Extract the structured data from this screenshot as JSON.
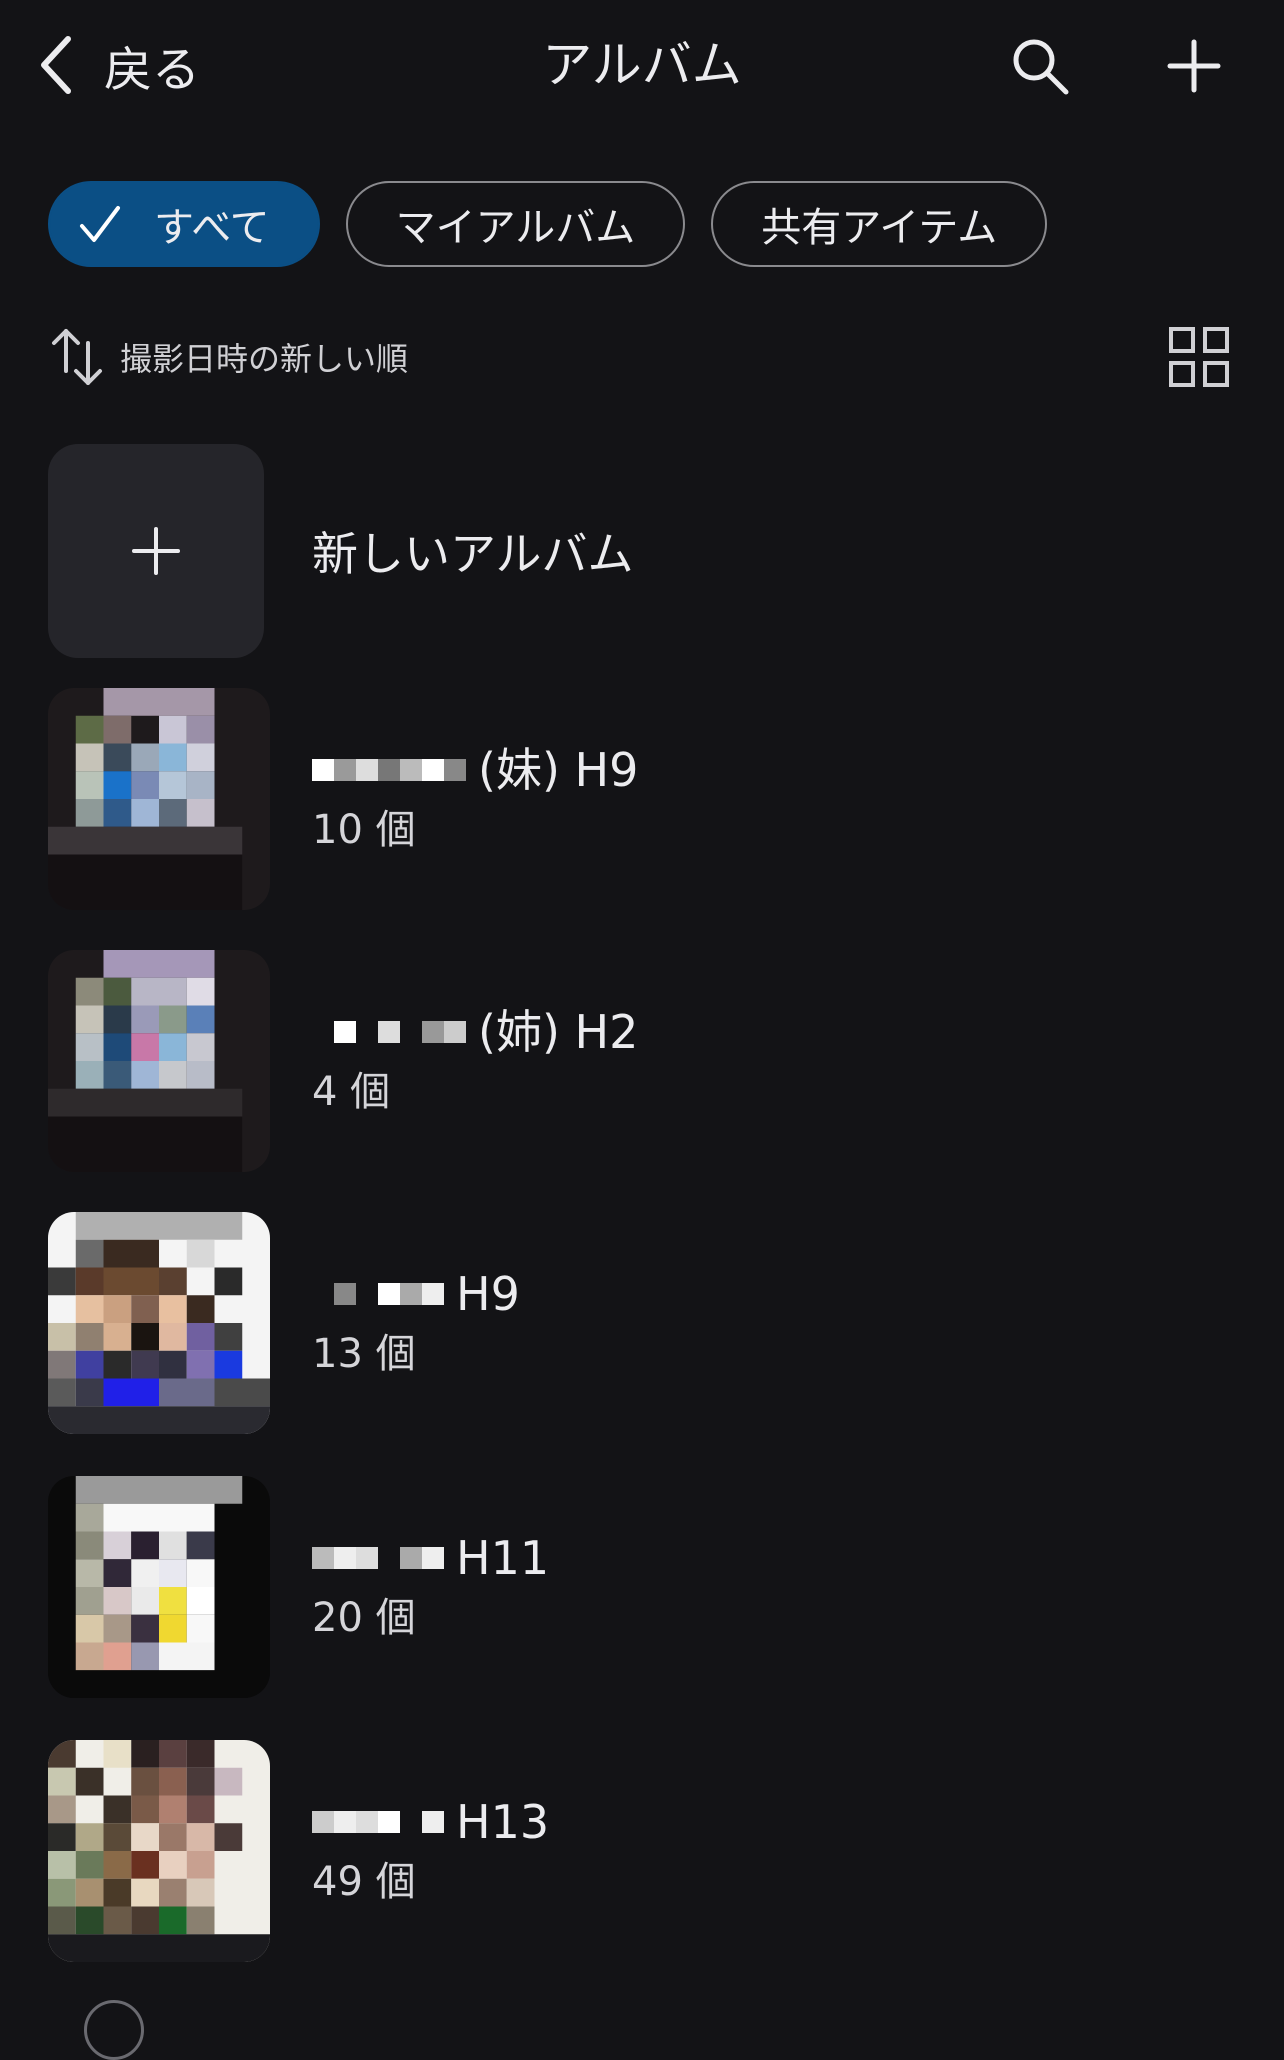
{
  "header": {
    "back_label": "戻る",
    "title": "アルバム",
    "search_icon": "search-icon",
    "add_icon": "plus-icon"
  },
  "filters": {
    "chips": [
      {
        "label": "すべて",
        "active": true
      },
      {
        "label": "マイアルバム",
        "active": false
      },
      {
        "label": "共有アイテム",
        "active": false
      }
    ]
  },
  "sort": {
    "label": "撮影日時の新しい順",
    "icon": "sort-arrows-icon",
    "view_icon": "grid-view-icon"
  },
  "new_album": {
    "label": "新しいアルバム"
  },
  "albums": [
    {
      "name_suffix": "(妹) H9",
      "count": "10 個"
    },
    {
      "name_suffix": "(姉) H2",
      "count": "4 個"
    },
    {
      "name_suffix": "H9",
      "count": "13 個"
    },
    {
      "name_suffix": "H11",
      "count": "20 個"
    },
    {
      "name_suffix": "H13",
      "count": "49 個"
    }
  ],
  "colors": {
    "background": "#131316",
    "accent_chip": "#0b4f85",
    "tile": "#25252a"
  }
}
